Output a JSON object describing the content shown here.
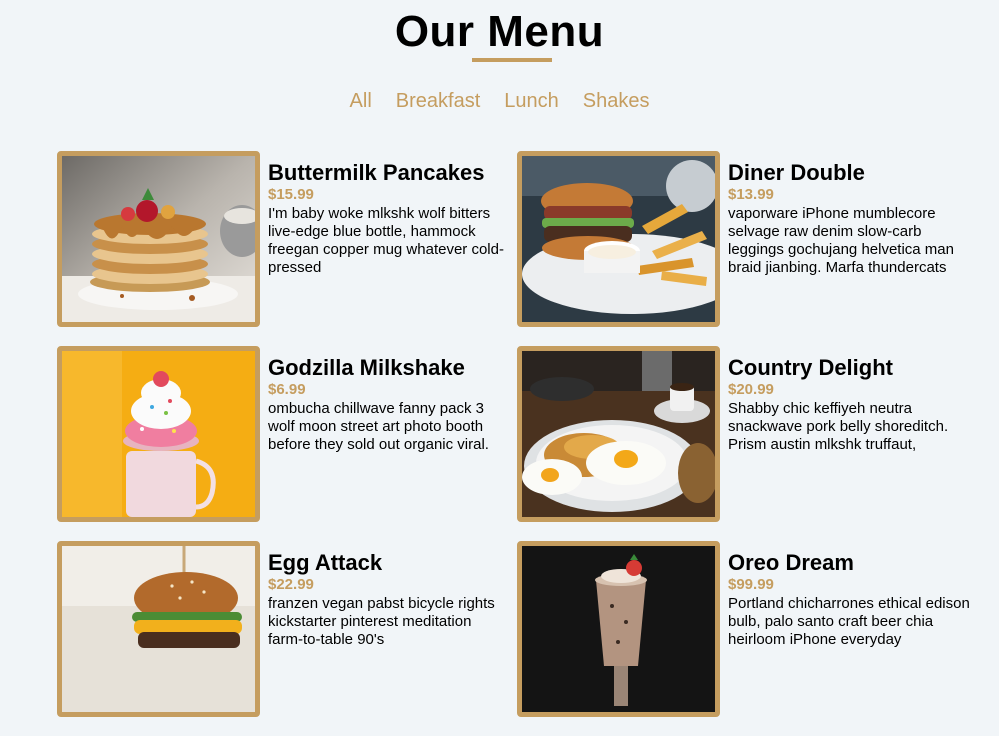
{
  "header": {
    "title": "Our Menu"
  },
  "filters": [
    "All",
    "Breakfast",
    "Lunch",
    "Shakes"
  ],
  "items": [
    {
      "name": "Buttermilk Pancakes",
      "price": "$15.99",
      "desc": "I'm baby woke mlkshk wolf bitters live-edge blue bottle, hammock freegan copper mug whatever cold-pressed",
      "image": "pancakes-photo"
    },
    {
      "name": "Diner Double",
      "price": "$13.99",
      "desc": "vaporware iPhone mumblecore selvage raw denim slow-carb leggings gochujang helvetica man braid jianbing. Marfa thundercats",
      "image": "burger-fries-photo"
    },
    {
      "name": "Godzilla Milkshake",
      "price": "$6.99",
      "desc": "ombucha chillwave fanny pack 3 wolf moon street art photo booth before they sold out organic viral.",
      "image": "milkshake-photo"
    },
    {
      "name": "Country Delight",
      "price": "$20.99",
      "desc": "Shabby chic keffiyeh neutra snackwave pork belly shoreditch. Prism austin mlkshk truffaut,",
      "image": "eggs-plate-photo"
    },
    {
      "name": "Egg Attack",
      "price": "$22.99",
      "desc": "franzen vegan pabst bicycle rights kickstarter pinterest meditation farm-to-table 90's",
      "image": "egg-burger-photo"
    },
    {
      "name": "Oreo Dream",
      "price": "$99.99",
      "desc": "Portland chicharrones ethical edison bulb, palo santo craft beer chia heirloom iPhone everyday",
      "image": "oreo-shake-photo"
    }
  ],
  "colors": {
    "accent": "#c59d5f",
    "background": "#f1f5f8"
  }
}
